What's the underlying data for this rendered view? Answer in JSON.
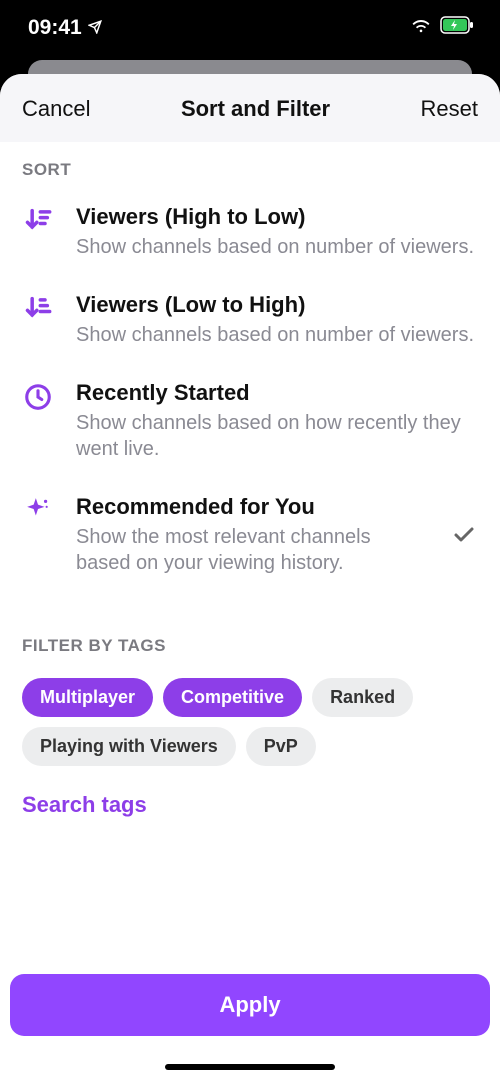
{
  "status": {
    "time": "09:41"
  },
  "sheet": {
    "cancel": "Cancel",
    "title": "Sort and Filter",
    "reset": "Reset"
  },
  "sort": {
    "label": "SORT",
    "options": [
      {
        "title": "Viewers (High to Low)",
        "desc": "Show channels based on number of viewers.",
        "selected": false
      },
      {
        "title": "Viewers (Low to High)",
        "desc": "Show channels based on number of viewers.",
        "selected": false
      },
      {
        "title": "Recently Started",
        "desc": "Show channels based on how recently they went live.",
        "selected": false
      },
      {
        "title": "Recommended for You",
        "desc": "Show the most relevant channels based on your viewing history.",
        "selected": true
      }
    ]
  },
  "filter": {
    "label": "FILTER BY TAGS",
    "tags": [
      {
        "label": "Multiplayer",
        "selected": true
      },
      {
        "label": "Competitive",
        "selected": true
      },
      {
        "label": "Ranked",
        "selected": false
      },
      {
        "label": "Playing with Viewers",
        "selected": false
      },
      {
        "label": "PvP",
        "selected": false
      }
    ],
    "search": "Search tags"
  },
  "apply": "Apply"
}
